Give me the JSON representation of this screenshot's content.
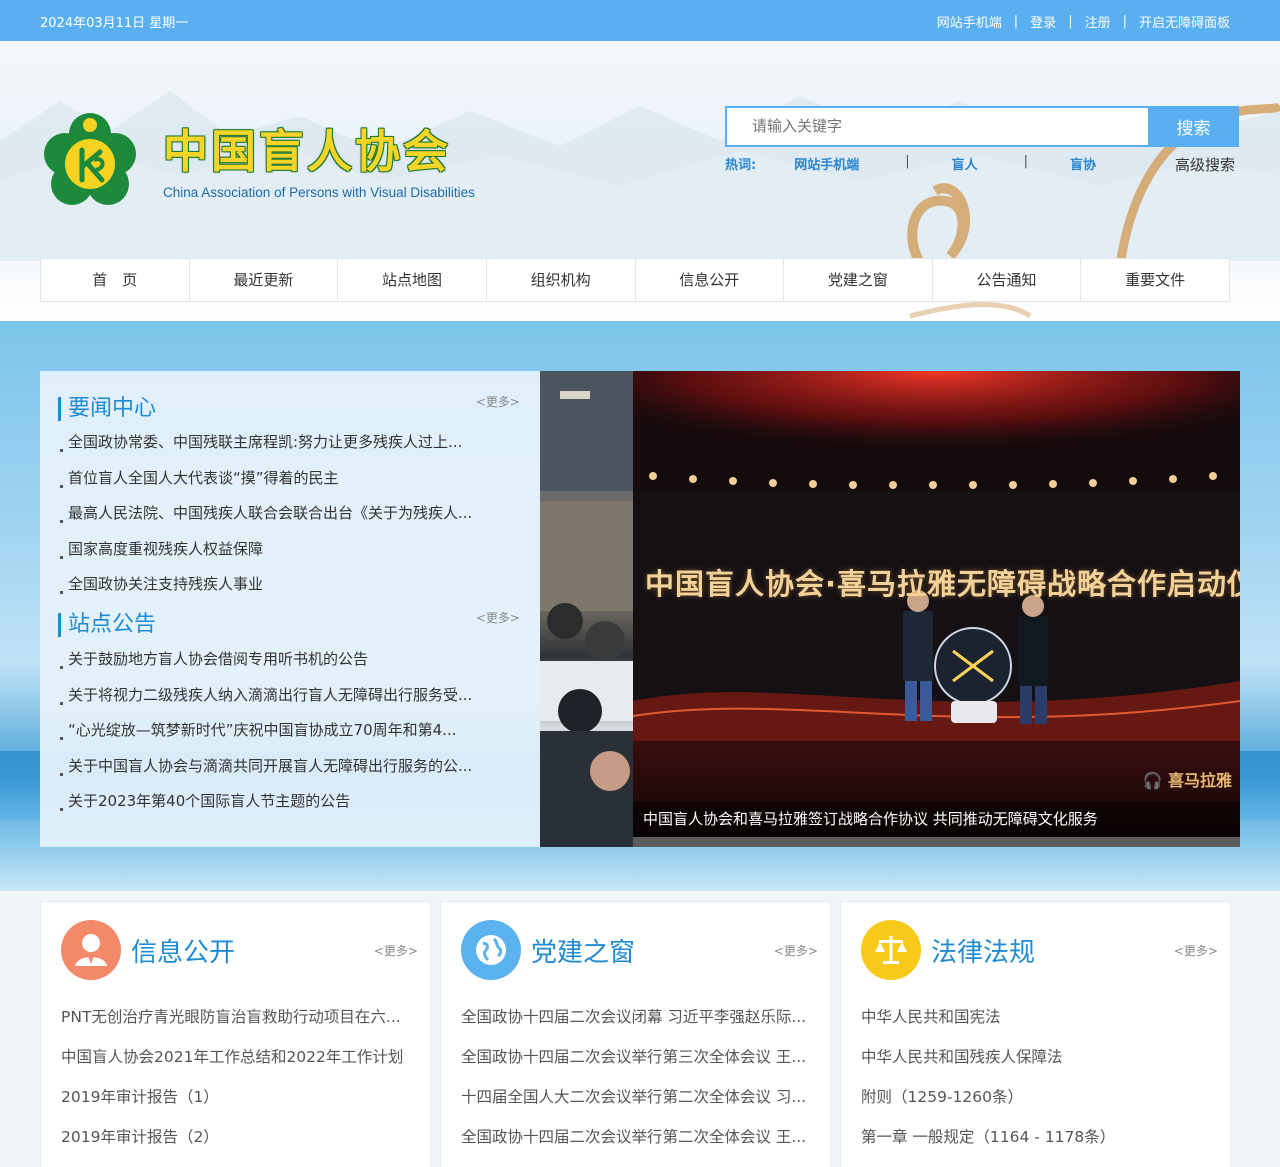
{
  "topbar": {
    "date": "2024年03月11日 星期一",
    "links": [
      "网站手机端",
      "登录",
      "注册",
      "开启无障碍面板"
    ],
    "separator": "|"
  },
  "header": {
    "org_name_cn": "中国盲人协会",
    "org_name_en": "China Association of Persons with Visual Disabilities",
    "search_placeholder": "请输入关键字",
    "search_button": "搜索",
    "hot_label": "热词:",
    "hot_words": [
      "网站手机端",
      "盲人",
      "盲协"
    ],
    "advanced_search": "高级搜索"
  },
  "nav": [
    "首　页",
    "最近更新",
    "站点地图",
    "组织机构",
    "信息公开",
    "党建之窗",
    "公告通知",
    "重要文件"
  ],
  "news": {
    "title": "要闻中心",
    "more": "<更多>",
    "items": [
      "全国政协常委、中国残联主席程凯:努力让更多残疾人过上...",
      "首位盲人全国人大代表谈“摸”得着的民主",
      "最高人民法院、中国残疾人联合会联合出台《关于为残疾人...",
      "国家高度重视残疾人权益保障",
      "全国政协关注支持残疾人事业"
    ]
  },
  "notices": {
    "title": "站点公告",
    "more": "<更多>",
    "items": [
      "关于鼓励地方盲人协会借阅专用听书机的公告",
      "关于将视力二级残疾人纳入滴滴出行盲人无障碍出行服务受...",
      "“心光绽放—筑梦新时代”庆祝中国盲协成立70周年和第4...",
      "关于中国盲人协会与滴滴共同开展盲人无障碍出行服务的公...",
      "关于2023年第40个国际盲人节主题的公告"
    ]
  },
  "slide": {
    "headline": "中国盲人协会·喜马拉雅无障碍战略合作启动仪",
    "brand": "喜马拉雅",
    "caption": "中国盲人协会和喜马拉雅签订战略合作协议 共同推动无障碍文化服务"
  },
  "cards": [
    {
      "title": "信息公开",
      "more": "<更多>",
      "icon": "person-icon",
      "color": "#f28a6a",
      "items": [
        "PNT无创治疗青光眼防盲治盲救助行动项目在六...",
        "中国盲人协会2021年工作总结和2022年工作计划",
        "2019年审计报告（1）",
        "2019年审计报告（2）"
      ]
    },
    {
      "title": "党建之窗",
      "more": "<更多>",
      "icon": "globe-icon",
      "color": "#5ab2ee",
      "items": [
        "全国政协十四届二次会议闭幕 习近平李强赵乐际...",
        "全国政协十四届二次会议举行第三次全体会议 王...",
        "十四届全国人大二次会议举行第二次全体会议 习...",
        "全国政协十四届二次会议举行第二次全体会议 王..."
      ]
    },
    {
      "title": "法律法规",
      "more": "<更多>",
      "icon": "scale-icon",
      "color": "#f7c919",
      "items": [
        "中华人民共和国宪法",
        "中华人民共和国残疾人保障法",
        "附则（1259-1260条）",
        "第一章 一般规定（1164 - 1178条）"
      ]
    }
  ]
}
